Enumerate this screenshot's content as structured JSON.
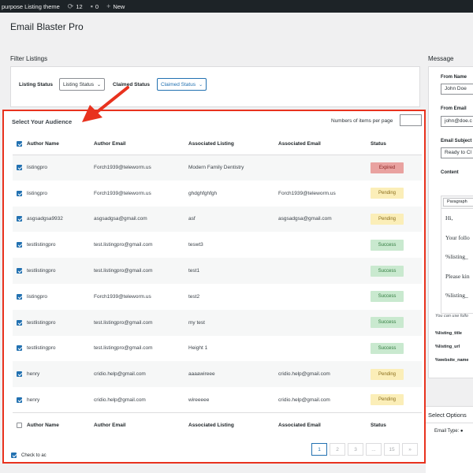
{
  "admin_bar": {
    "site_name": "purpose Listing theme",
    "updates_count": "12",
    "comments_count": "0",
    "new_label": "New"
  },
  "page_title": "Email Blaster Pro",
  "filter": {
    "title": "Filter Listings",
    "listing_status_label": "Listing Status",
    "listing_status_value": "Listing Status",
    "claimed_status_label": "Claimed Status",
    "claimed_status_value": "Claimed Status"
  },
  "audience": {
    "title": "Select Your Audience",
    "per_page_label": "Numbers of items per page",
    "per_page_value": "",
    "columns": [
      "Author Name",
      "Author Email",
      "Associated Listing",
      "Associated Email",
      "Status"
    ],
    "rows": [
      {
        "checked": true,
        "name": "listingpro",
        "email": "Forch1939@teleworm.us",
        "listing": "Modern Family Dentistry",
        "assoc_email": "",
        "status": "Expired"
      },
      {
        "checked": true,
        "name": "listingpro",
        "email": "Forch1939@teleworm.us",
        "listing": "ghdghfghfgh",
        "assoc_email": "Forch1939@teleworm.us",
        "status": "Pending"
      },
      {
        "checked": true,
        "name": "asgsadgsa9932",
        "email": "asgsadgsa@gmail.com",
        "listing": "asf",
        "assoc_email": "asgsadgsa@gmail.com",
        "status": "Pending"
      },
      {
        "checked": true,
        "name": "testlistingpro",
        "email": "test.listingpro@gmail.com",
        "listing": "teswt3",
        "assoc_email": "",
        "status": "Success"
      },
      {
        "checked": true,
        "name": "testlistingpro",
        "email": "test.listingpro@gmail.com",
        "listing": "test1",
        "assoc_email": "",
        "status": "Success"
      },
      {
        "checked": true,
        "name": "listingpro",
        "email": "Forch1939@teleworm.us",
        "listing": "test2",
        "assoc_email": "",
        "status": "Success"
      },
      {
        "checked": true,
        "name": "testlistingpro",
        "email": "test.listingpro@gmail.com",
        "listing": "my test",
        "assoc_email": "",
        "status": "Success"
      },
      {
        "checked": true,
        "name": "testlistingpro",
        "email": "test.listingpro@gmail.com",
        "listing": "Height 1",
        "assoc_email": "",
        "status": "Success"
      },
      {
        "checked": true,
        "name": "henry",
        "email": "cridio.help@gmail.com",
        "listing": "aaaawireee",
        "assoc_email": "cridio.help@gmail.com",
        "status": "Pending"
      },
      {
        "checked": true,
        "name": "henry",
        "email": "cridio.help@gmail.com",
        "listing": "wireeeee",
        "assoc_email": "cridio.help@gmail.com",
        "status": "Pending"
      }
    ],
    "pagination": [
      "1",
      "2",
      "3",
      "...",
      "15",
      "»"
    ],
    "current_page": "1"
  },
  "message": {
    "title": "Message",
    "from_name_label": "From Name",
    "from_name_value": "John Doe",
    "from_email_label": "From Email",
    "from_email_value": "john@doe.c",
    "subject_label": "Email Subject",
    "subject_value": "Ready to Cl",
    "content_label": "Content",
    "format_value": "Paragraph",
    "body_lines": [
      "Hi,",
      "Your follo",
      "%listing_",
      "Please kin",
      "%listing_"
    ],
    "note": "You can use follo",
    "tags": [
      "%listing_title",
      "%listing_url",
      "%website_name"
    ]
  },
  "options": {
    "title": "Select Options",
    "email_type_label": "Email Type:",
    "check_label": "Check to ac"
  },
  "colors": {
    "highlight": "#e8321e",
    "accent": "#2271b1",
    "expired_bg": "#e9a2a0",
    "pending_bg": "#fbeeb8",
    "success_bg": "#c9e9cf"
  }
}
